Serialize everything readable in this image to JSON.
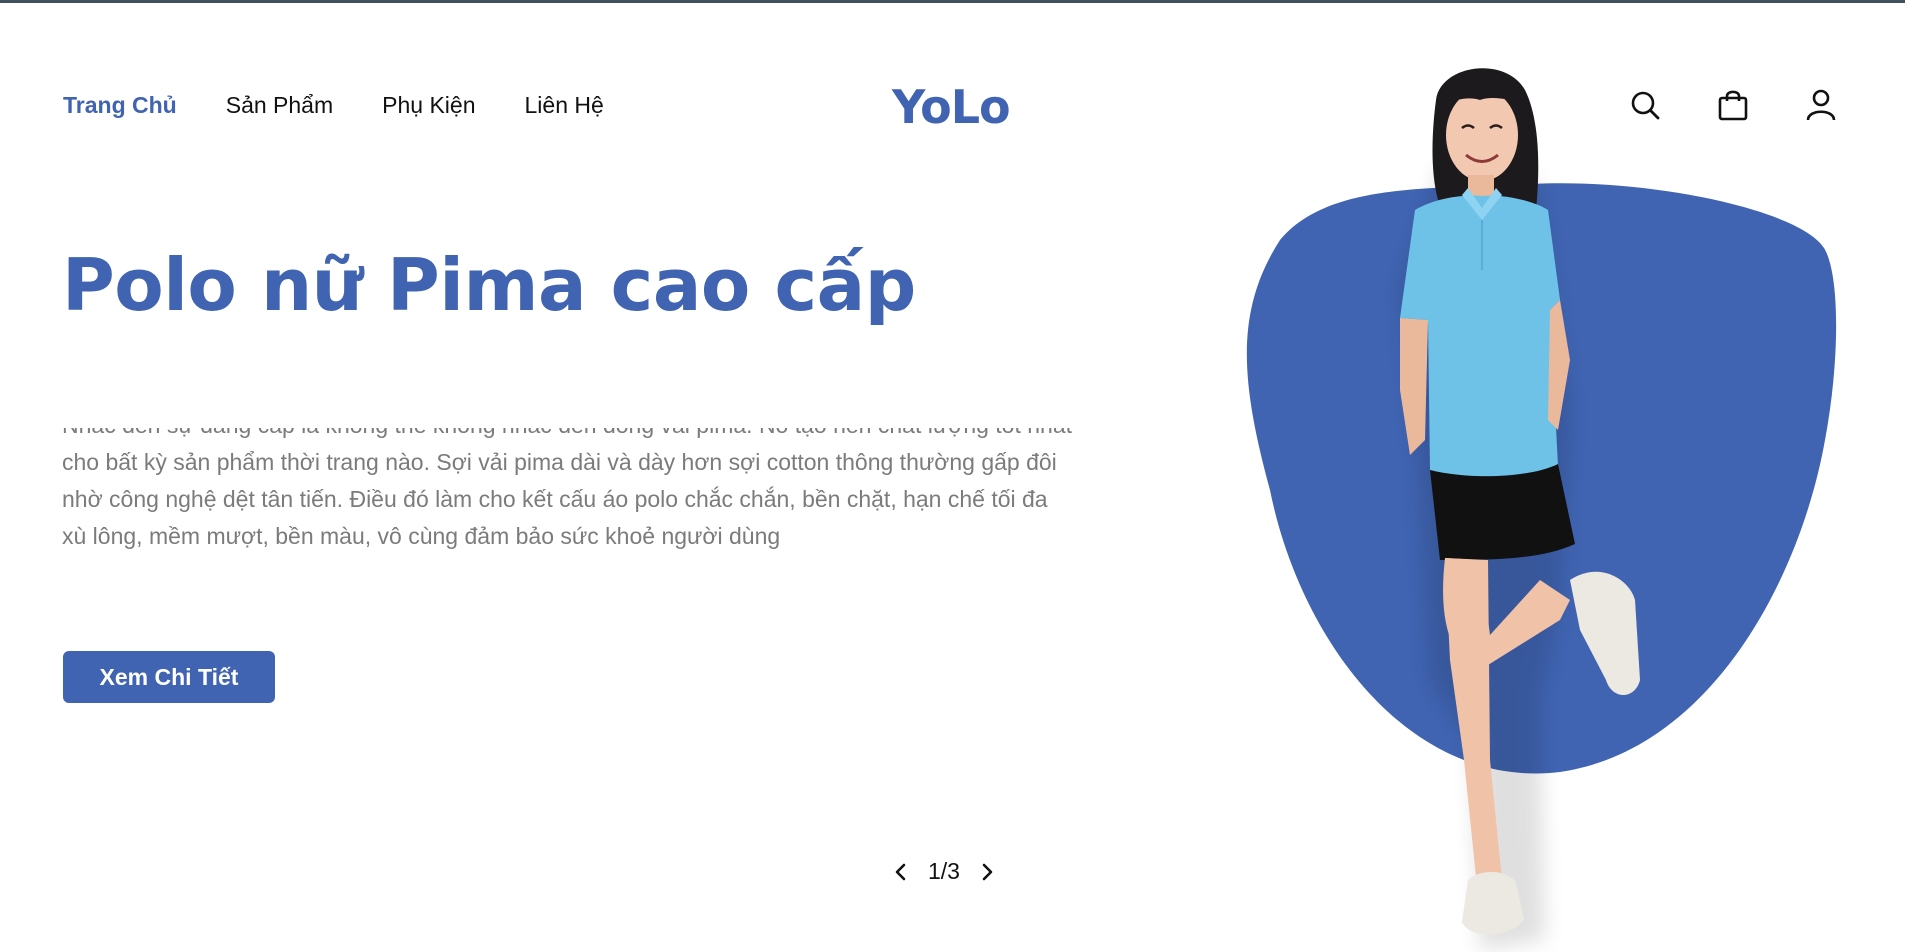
{
  "topbar": {
    "accent": "#41505c"
  },
  "nav": {
    "items": [
      {
        "label": "Trang Chủ",
        "active": true
      },
      {
        "label": "Sản Phẩm",
        "active": false
      },
      {
        "label": "Phụ Kiện",
        "active": false
      },
      {
        "label": "Liên Hệ",
        "active": false
      }
    ]
  },
  "logo": {
    "text": "YoLo",
    "color": "#4064b2"
  },
  "header_icons": {
    "search": "search-icon",
    "cart": "shopping-bag-icon",
    "account": "user-icon"
  },
  "hero": {
    "title": "Polo nữ Pima cao cấp",
    "description": "Nhắc đến sự đẳng cấp là không thể không nhắc đến dòng vải pima. Nó tạo nên chất lượng tốt nhất cho bất kỳ sản phẩm thời trang nào. Sợi vải pima dài và dày hơn sợi cotton thông thường gấp đôi nhờ công nghệ dệt tân tiến. Điều đó làm cho kết cấu áo polo chắc chắn, bền chặt, hạn chế tối đa xù lông, mềm mượt, bền màu, vô cùng đảm bảo sức khoẻ người dùng",
    "cta_label": "Xem Chi Tiết",
    "image": "woman-in-light-blue-polo-photo",
    "blob_color": "#4064b2"
  },
  "pager": {
    "current": "1/3",
    "prev_icon": "chevron-left-icon",
    "next_icon": "chevron-right-icon"
  }
}
